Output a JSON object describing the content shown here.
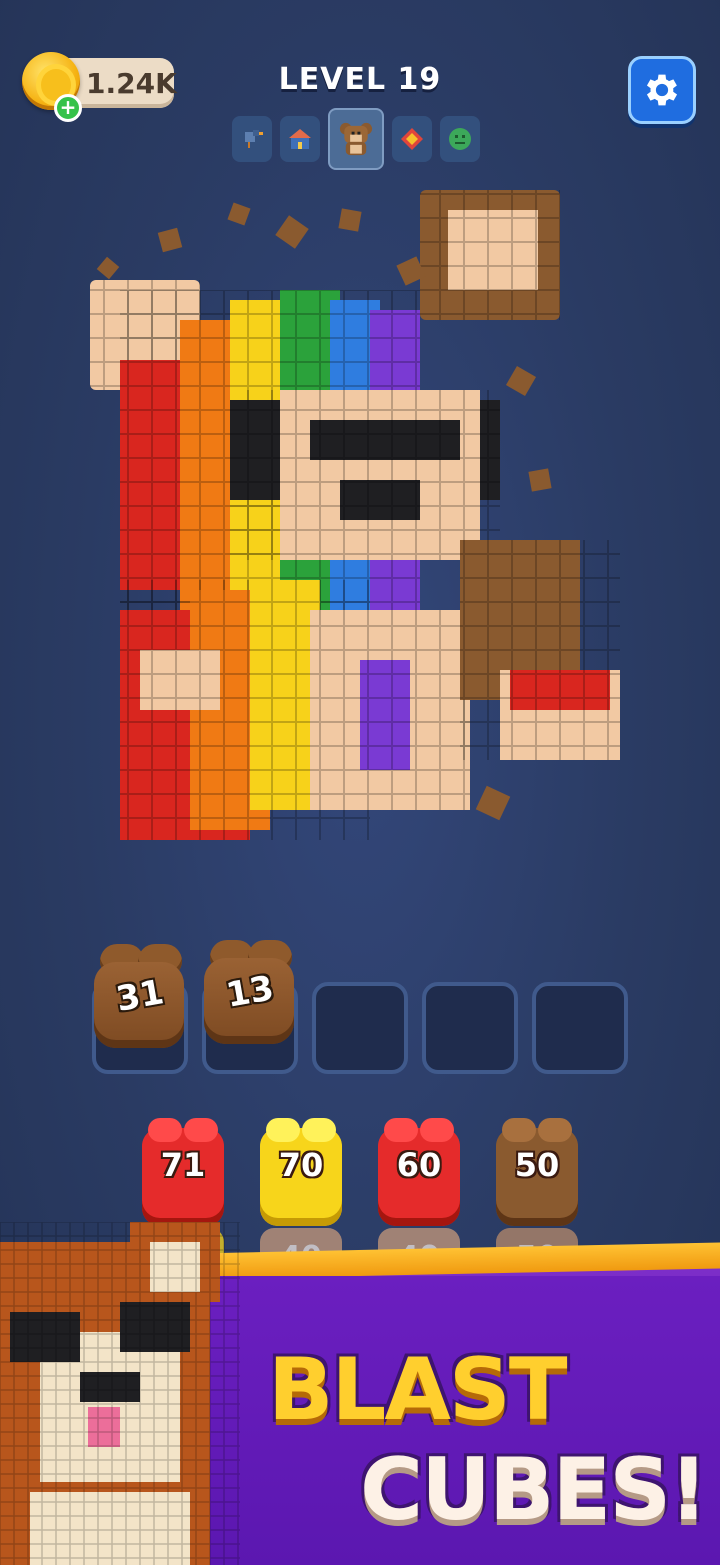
{
  "hud": {
    "coins": "1.24K",
    "level_title": "LEVEL 19",
    "settings_icon": "gear-icon"
  },
  "level_previews": [
    {
      "icon": "bird-icon",
      "color": "#5d7fb0"
    },
    {
      "icon": "house-icon",
      "color": "#e36b4a"
    },
    {
      "icon": "teddy-bear-icon",
      "color": "#8a5a2f",
      "current": true
    },
    {
      "icon": "diamond-icon",
      "color": "#e0453b"
    },
    {
      "icon": "smiley-icon",
      "color": "#3ca85a"
    }
  ],
  "slots": {
    "filled": [
      "31",
      "13"
    ],
    "empty_count": 3
  },
  "queue": [
    {
      "front": "71",
      "back": "",
      "color": "#e52b2b",
      "top_color": "#ff4a4a"
    },
    {
      "front": "70",
      "back": "40",
      "color": "#f7d51b",
      "top_color": "#fff25a"
    },
    {
      "front": "60",
      "back": "40",
      "color": "#e52b2b",
      "top_color": "#ff4a4a"
    },
    {
      "front": "50",
      "back": "50",
      "color": "#8a5a2f",
      "top_color": "#a8703e"
    }
  ],
  "banner": {
    "line1": "BLAST",
    "line2": "CUBES!"
  },
  "colors": {
    "background": "#2a3b63",
    "banner_purple": "#6b1fc0",
    "banner_yellow": "#ffcf2e"
  }
}
